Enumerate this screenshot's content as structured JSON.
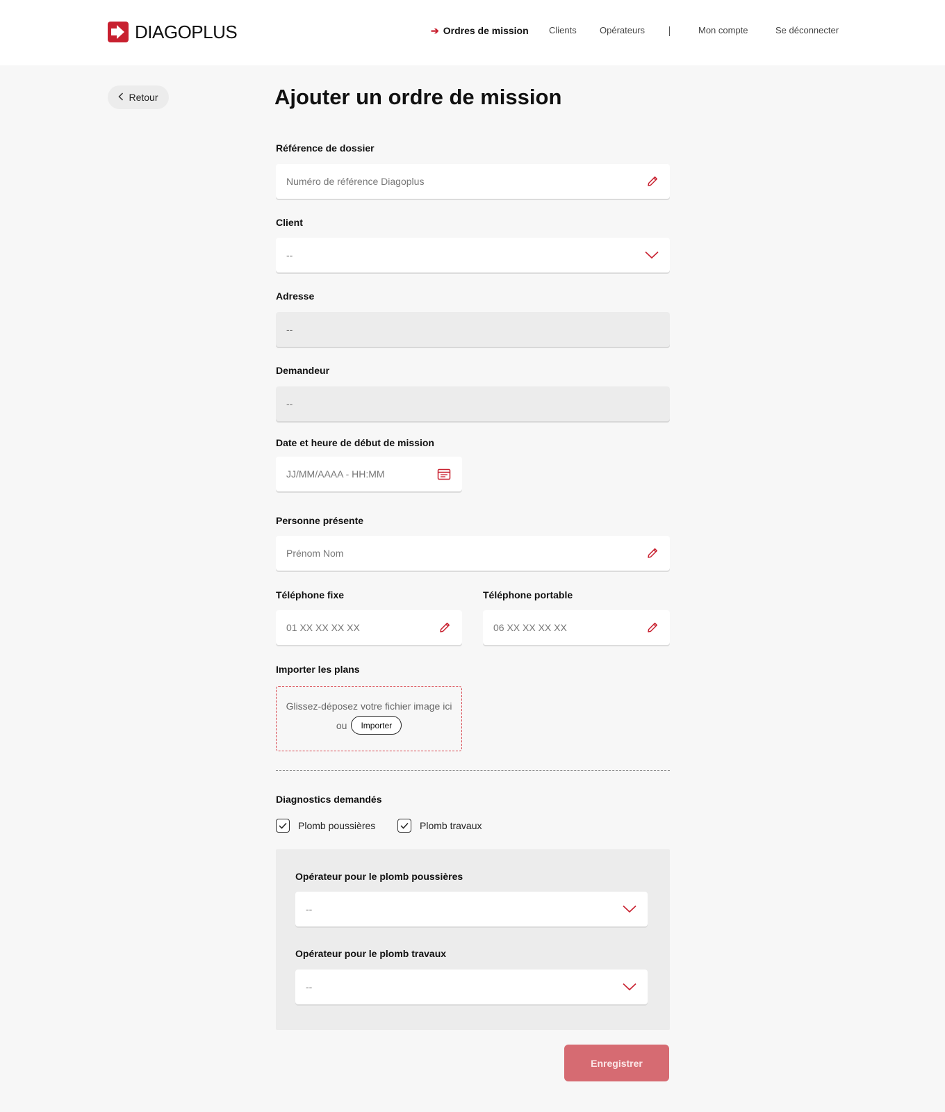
{
  "brand": {
    "name_part1": "DIAGO",
    "name_part2": "PLUS",
    "accent": "#c8202f"
  },
  "nav": {
    "active_label": "Ordres de mission",
    "items": [
      "Clients",
      "Opérateurs",
      "Mon compte",
      "Se déconnecter"
    ]
  },
  "back_label": "Retour",
  "title": "Ajouter un ordre de mission",
  "form": {
    "reference": {
      "label": "Référence de dossier",
      "placeholder": "Numéro de référence Diagoplus"
    },
    "client": {
      "label": "Client",
      "value": "--"
    },
    "adresse": {
      "label": "Adresse",
      "value": "--"
    },
    "demandeur": {
      "label": "Demandeur",
      "value": "--"
    },
    "date": {
      "label": "Date et heure de début de mission",
      "placeholder": "JJ/MM/AAAA - HH:MM"
    },
    "personne": {
      "label": "Personne présente",
      "placeholder": "Prénom Nom"
    },
    "tel_fixe": {
      "label": "Téléphone fixe",
      "placeholder": "01 XX XX XX XX"
    },
    "tel_portable": {
      "label": "Téléphone portable",
      "placeholder": "06 XX XX XX XX"
    },
    "plans": {
      "label": "Importer les plans",
      "drop_text": "Glissez-déposez votre fichier image ici",
      "or_text": "ou",
      "import_label": "Importer"
    },
    "diagnostics": {
      "label": "Diagnostics demandés",
      "options": [
        {
          "label": "Plomb poussières",
          "checked": true
        },
        {
          "label": "Plomb travaux",
          "checked": true
        }
      ]
    },
    "op_poussieres": {
      "label": "Opérateur pour le plomb poussières",
      "value": "--"
    },
    "op_travaux": {
      "label": "Opérateur pour le plomb travaux",
      "value": "--"
    }
  },
  "save_label": "Enregistrer"
}
